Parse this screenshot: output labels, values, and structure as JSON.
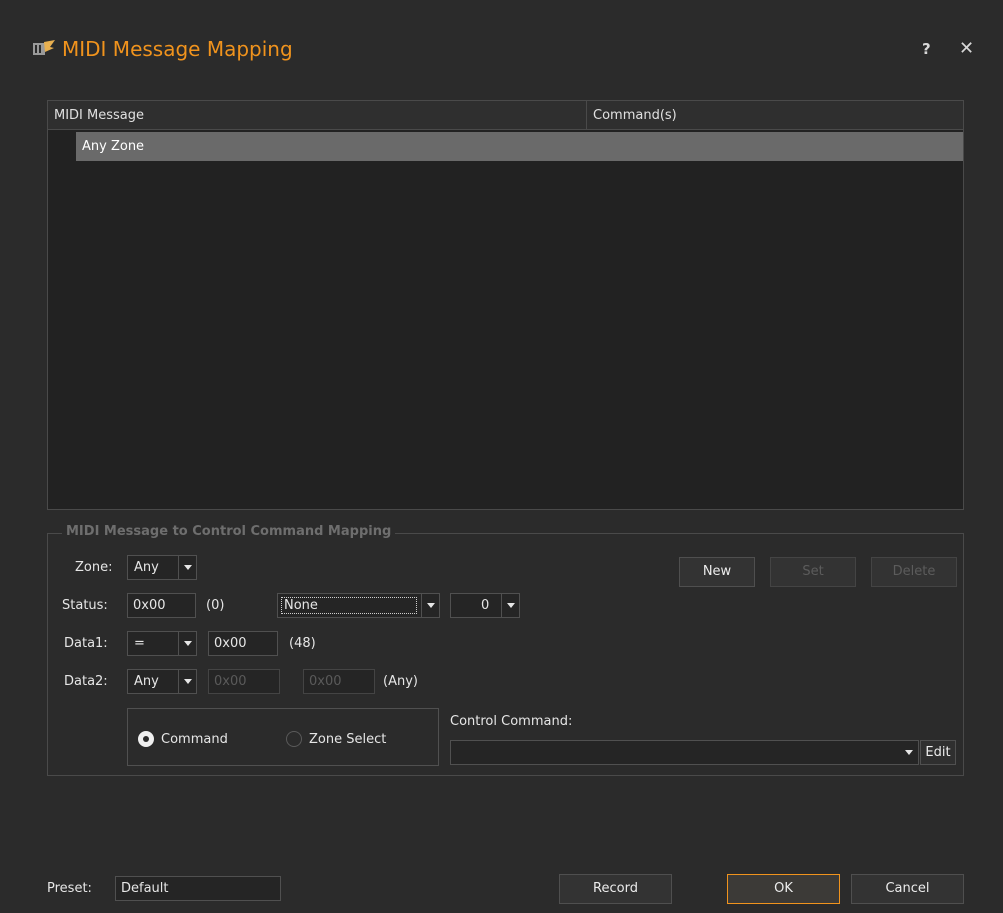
{
  "window": {
    "title": "MIDI Message Mapping",
    "help_label": "?",
    "close_label": "✕",
    "accent_color": "#f0931d"
  },
  "list": {
    "columns": [
      "MIDI Message",
      "Command(s)"
    ],
    "rows": [
      {
        "label": "Any Zone"
      }
    ]
  },
  "mapping": {
    "group_title": "MIDI Message to Control Command Mapping",
    "zone": {
      "label": "Zone:",
      "value": "Any"
    },
    "status": {
      "label": "Status:",
      "value": "0x00",
      "decimal": "(0)",
      "type_value": "None",
      "channel_value": "0"
    },
    "data1": {
      "label": "Data1:",
      "operator": "=",
      "value": "0x00",
      "decimal": "(48)"
    },
    "data2": {
      "label": "Data2:",
      "operator": "Any",
      "value1_placeholder": "0x00",
      "value2_placeholder": "0x00",
      "note": "(Any)"
    },
    "buttons": {
      "new": "New",
      "set": "Set",
      "delete": "Delete"
    },
    "radio": {
      "command": "Command",
      "zone_select": "Zone Select",
      "selected": "Command"
    },
    "control_command": {
      "label": "Control Command:",
      "value": "",
      "edit": "Edit"
    }
  },
  "footer": {
    "preset_label": "Preset:",
    "preset_value": "Default",
    "record": "Record",
    "ok": "OK",
    "cancel": "Cancel"
  }
}
